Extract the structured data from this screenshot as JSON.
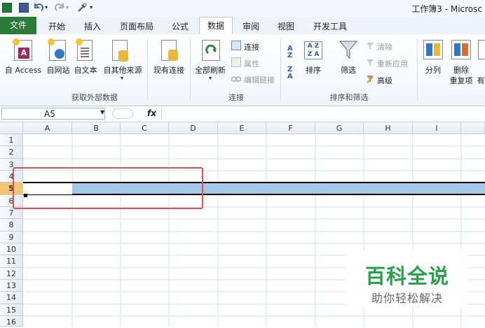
{
  "window": {
    "title": "工作簿3 - Microsc"
  },
  "tabs": [
    {
      "label": "文件"
    },
    {
      "label": "开始"
    },
    {
      "label": "插入"
    },
    {
      "label": "页面布局"
    },
    {
      "label": "公式"
    },
    {
      "label": "数据"
    },
    {
      "label": "审阅"
    },
    {
      "label": "视图"
    },
    {
      "label": "开发工具"
    }
  ],
  "ribbon": {
    "get_external": {
      "group_label": "获取外部数据",
      "from_access": "自 Access",
      "from_web": "自网站",
      "from_text": "自文本",
      "from_other": "自其他来源",
      "existing": "现有连接"
    },
    "connections": {
      "group_label": "连接",
      "refresh_all": "全部刷新",
      "connections": "连接",
      "properties": "属性",
      "edit_links": "编辑链接"
    },
    "sort_filter": {
      "group_label": "排序和筛选",
      "sort": "排序",
      "filter": "筛选",
      "clear": "清除",
      "reapply": "重新应用",
      "advanced": "高级"
    },
    "data_tools": {
      "text_to_columns": "分列",
      "remove_dup_1": "删除",
      "remove_dup_2": "重复项",
      "partial": "有"
    }
  },
  "formula_bar": {
    "name_box": "A5",
    "fx": "fx",
    "content": ""
  },
  "grid": {
    "columns": [
      "A",
      "B",
      "C",
      "D",
      "E",
      "F",
      "G",
      "H",
      "I"
    ],
    "rows": [
      "1",
      "2",
      "3",
      "4",
      "5",
      "6",
      "7",
      "8",
      "9",
      "10",
      "11",
      "12",
      "13",
      "14",
      "15",
      "16"
    ],
    "selected_cell": "A5",
    "selected_row": "5"
  },
  "watermark": {
    "title": "百科全说",
    "subtitle": "助你轻松解决"
  },
  "colors": {
    "file_tab": "#2a7b3a",
    "selection": "#a6c8e8",
    "highlight_box": "#e05050",
    "watermark": "#27a24a"
  }
}
